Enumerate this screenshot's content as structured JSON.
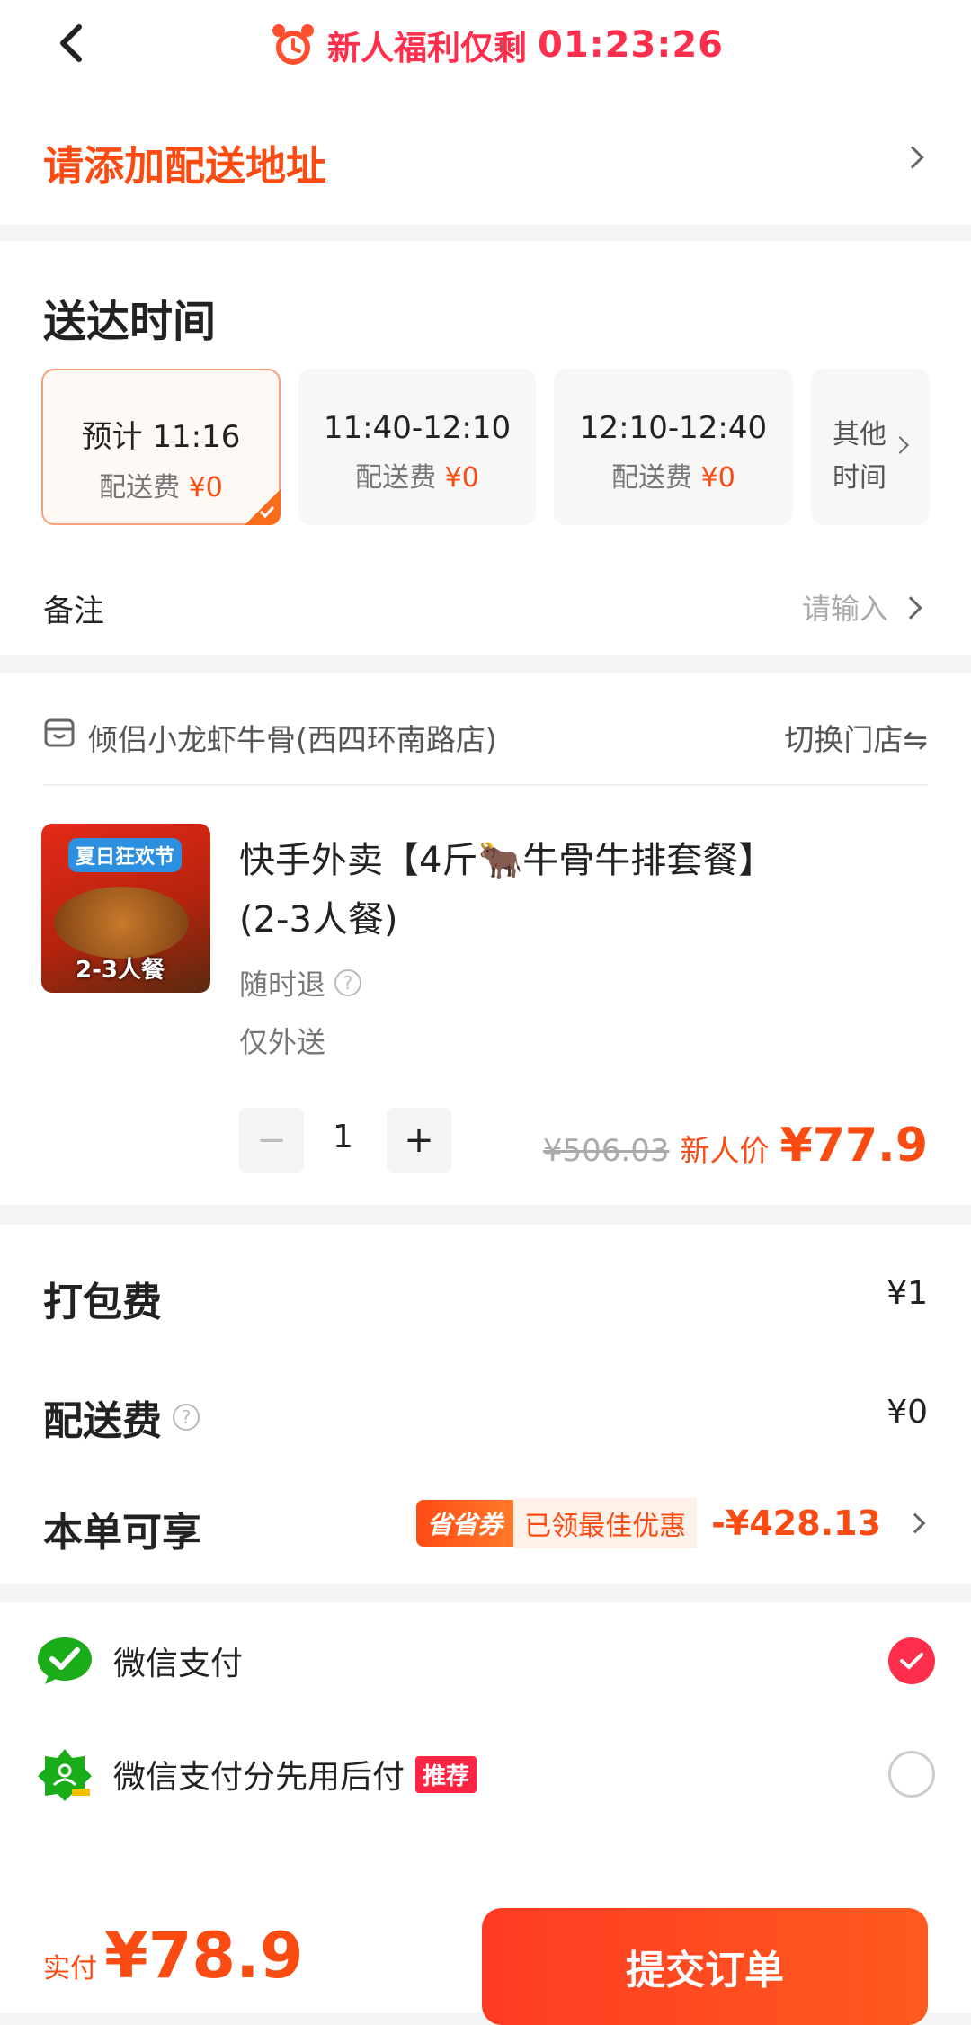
{
  "header": {
    "promo_text": "新人福利仅剩",
    "countdown": "01:23:26"
  },
  "address": {
    "prompt": "请添加配送地址"
  },
  "delivery": {
    "title": "送达时间",
    "slots": [
      {
        "time": "预计 11:16",
        "fee_label": "配送费",
        "fee": "¥0"
      },
      {
        "time": "11:40-12:10",
        "fee_label": "配送费",
        "fee": "¥0"
      },
      {
        "time": "12:10-12:40",
        "fee_label": "配送费",
        "fee": "¥0"
      },
      {
        "time": "其他",
        "fee_label": "时间",
        "fee": ""
      }
    ]
  },
  "note": {
    "label": "备注",
    "placeholder": "请输入"
  },
  "store": {
    "name": "倾侣小龙虾牛骨(西四环南路店)",
    "switch_label": "切换门店⇋"
  },
  "product": {
    "image_tag": "夏日狂欢节",
    "image_sub": "2-3人餐",
    "title_line1": "快手外卖【4斤🐂牛骨牛排套餐】",
    "title_line2": "(2-3人餐)",
    "refund": "随时退",
    "delivery_only": "仅外送",
    "quantity": "1",
    "original_price": "¥506.03",
    "price_label": "新人价",
    "price": "¥77.9"
  },
  "fees": {
    "packing_label": "打包费",
    "packing_value": "¥1",
    "delivery_label": "配送费",
    "delivery_value": "¥0",
    "discount_label": "本单可享",
    "coupon_tag": "省省券",
    "coupon_text": "已领最佳优惠",
    "discount_value": "-¥428.13"
  },
  "payment": {
    "options": [
      {
        "name": "微信支付",
        "selected": true
      },
      {
        "name": "微信支付分先用后付",
        "tag": "推荐",
        "selected": false
      }
    ]
  },
  "footer": {
    "paid_label": "实付",
    "total": "¥78.9",
    "submit": "提交订单"
  }
}
